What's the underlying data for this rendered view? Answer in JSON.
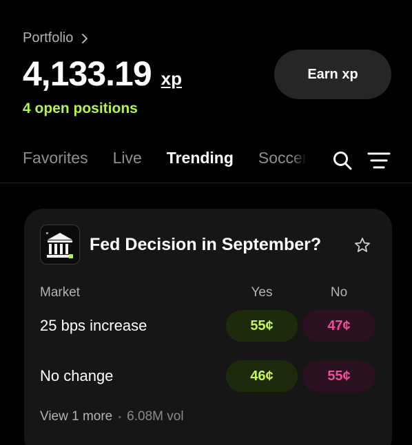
{
  "portfolio": {
    "label": "Portfolio",
    "balance": "4,133.19",
    "unit": "xp",
    "open_positions": "4 open positions"
  },
  "earn_button": {
    "label": "Earn xp"
  },
  "tabs": [
    {
      "label": "Favorites",
      "active": false
    },
    {
      "label": "Live",
      "active": false
    },
    {
      "label": "Trending",
      "active": true
    },
    {
      "label": "Soccer",
      "active": false
    }
  ],
  "market": {
    "title": "Fed Decision in September?",
    "columns": {
      "market": "Market",
      "yes": "Yes",
      "no": "No"
    },
    "rows": [
      {
        "label": "25 bps increase",
        "yes": "55¢",
        "no": "47¢"
      },
      {
        "label": "No change",
        "yes": "46¢",
        "no": "55¢"
      }
    ],
    "more_link": "View 1 more",
    "separator": "•",
    "volume": "6.08M vol"
  },
  "colors": {
    "background": "#000000",
    "accent_green": "#b5f24a",
    "yes_text": "#c8f55a",
    "yes_bg": "#1e2a0c",
    "no_text": "#ee4e9c",
    "no_bg": "#2c1120",
    "card_bg": "#161616",
    "button_bg": "#262626"
  },
  "icons": [
    "chevron-right-icon",
    "search-icon",
    "menu-icon",
    "bank-icon",
    "star-icon"
  ]
}
